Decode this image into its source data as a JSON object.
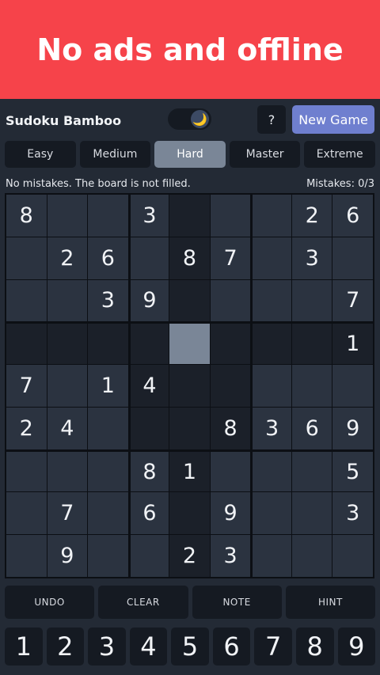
{
  "banner": {
    "text": "No ads and offline"
  },
  "app": {
    "title": "Sudoku Bamboo",
    "theme_icon": "moon-icon",
    "theme_glyph": "🌙",
    "help_label": "?",
    "new_game_label": "New Game"
  },
  "difficulty": {
    "levels": [
      "Easy",
      "Medium",
      "Hard",
      "Master",
      "Extreme"
    ],
    "selected": "Hard"
  },
  "status": {
    "message": "No mistakes. The board is not filled.",
    "mistakes": "Mistakes: 0/3"
  },
  "board": {
    "rows": [
      [
        "8",
        "",
        "",
        "3",
        "",
        "",
        "",
        "2",
        "6"
      ],
      [
        "",
        "2",
        "6",
        "",
        "8",
        "7",
        "",
        "3",
        ""
      ],
      [
        "",
        "",
        "3",
        "9",
        "",
        "",
        "",
        "",
        "7"
      ],
      [
        "",
        "",
        "",
        "",
        "",
        "",
        "",
        "",
        "1"
      ],
      [
        "7",
        "",
        "1",
        "4",
        "",
        "",
        "",
        "",
        ""
      ],
      [
        "2",
        "4",
        "",
        "",
        "",
        "8",
        "3",
        "6",
        "9"
      ],
      [
        "",
        "",
        "",
        "8",
        "1",
        "",
        "",
        "",
        "5"
      ],
      [
        "",
        "7",
        "",
        "6",
        "",
        "9",
        "",
        "",
        "3"
      ],
      [
        "",
        "9",
        "",
        "",
        "2",
        "3",
        "",
        "",
        ""
      ]
    ],
    "selected_cell": [
      3,
      4
    ]
  },
  "actions": [
    "UNDO",
    "CLEAR",
    "NOTE",
    "HINT"
  ],
  "numpad": [
    "1",
    "2",
    "3",
    "4",
    "5",
    "6",
    "7",
    "8",
    "9"
  ],
  "colors": {
    "banner": "#f6434a",
    "background": "#232a35",
    "accent": "#6f7fcf",
    "selected": "#7a8697"
  }
}
